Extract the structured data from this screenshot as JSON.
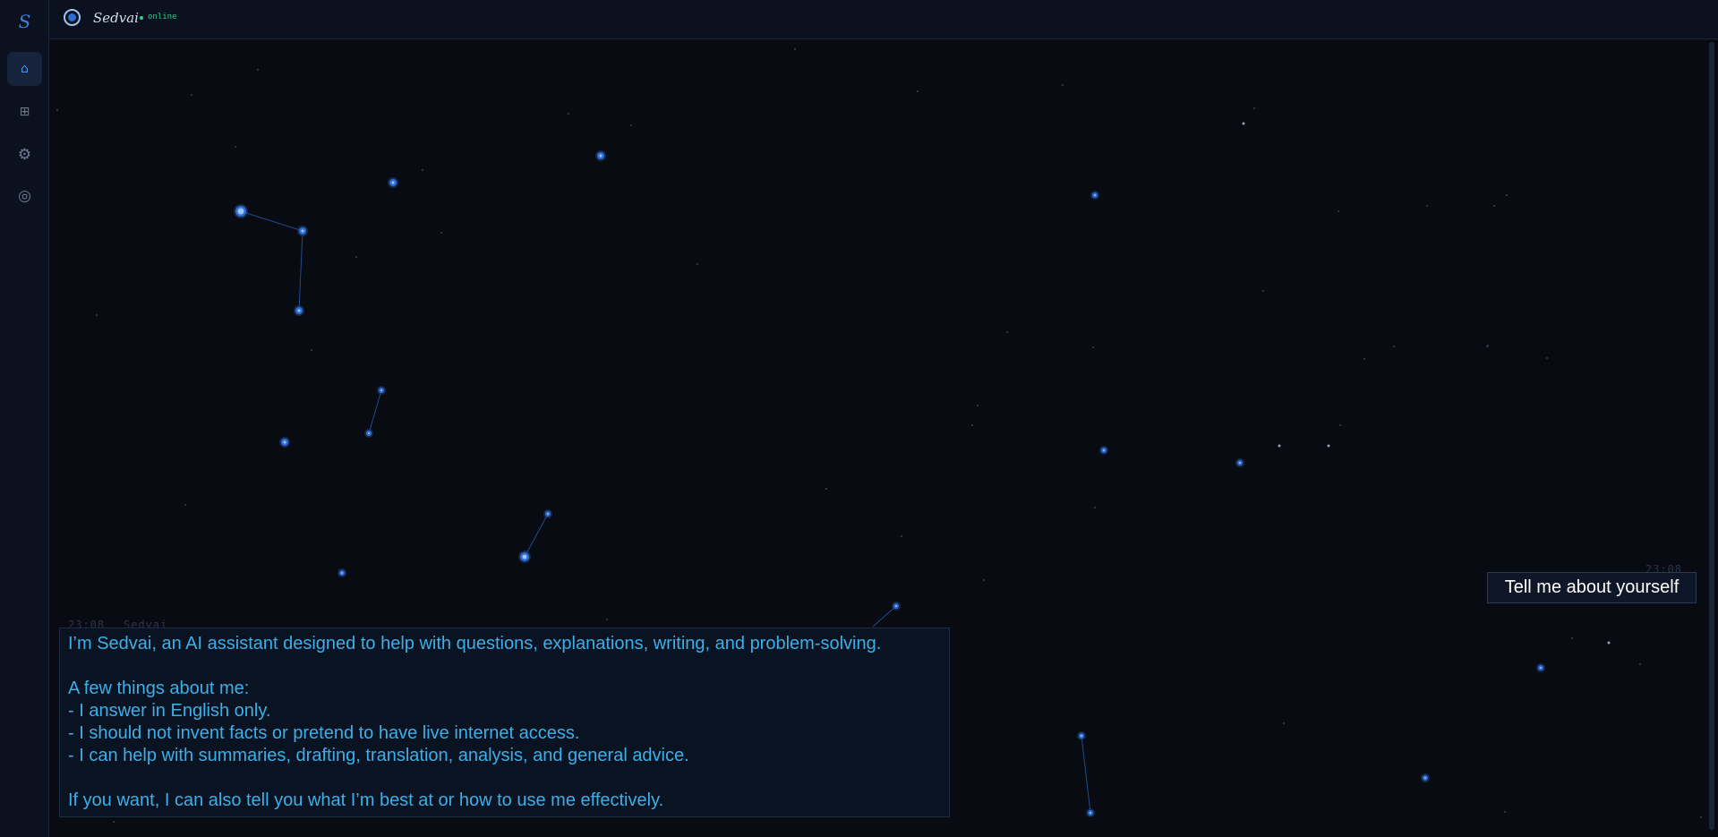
{
  "app": {
    "rail_logo": "S"
  },
  "sidebar": {
    "items": [
      {
        "name": "home",
        "glyph": "⌂",
        "active": true
      },
      {
        "name": "grid",
        "glyph": "⊞",
        "active": false
      },
      {
        "name": "settings",
        "glyph": "⚙",
        "active": false
      },
      {
        "name": "target",
        "glyph": "◎",
        "active": false
      }
    ]
  },
  "header": {
    "brand": "Sedvai",
    "status": "online",
    "status_color": "#2fce8e"
  },
  "chat": {
    "user_message": {
      "time": "23:08",
      "text": "Tell me about yourself"
    },
    "bot_message": {
      "time": "23:08",
      "sender": "Sedvai",
      "text": "I’m Sedvai, an AI assistant designed to help with questions, explanations, writing, and problem-solving.\n\nA few things about me:\n- I answer in English only.\n- I should not invent facts or pretend to have live internet access.\n- I can help with summaries, drafting, translation, analysis, and general advice.\n\nIf you want, I can also tell you what I’m best at or how to use me effectively."
    }
  },
  "colors": {
    "background": "#090b12",
    "accent": "#3d7fd6",
    "bot_text": "#3dafe8",
    "user_text": "#ffffff"
  }
}
